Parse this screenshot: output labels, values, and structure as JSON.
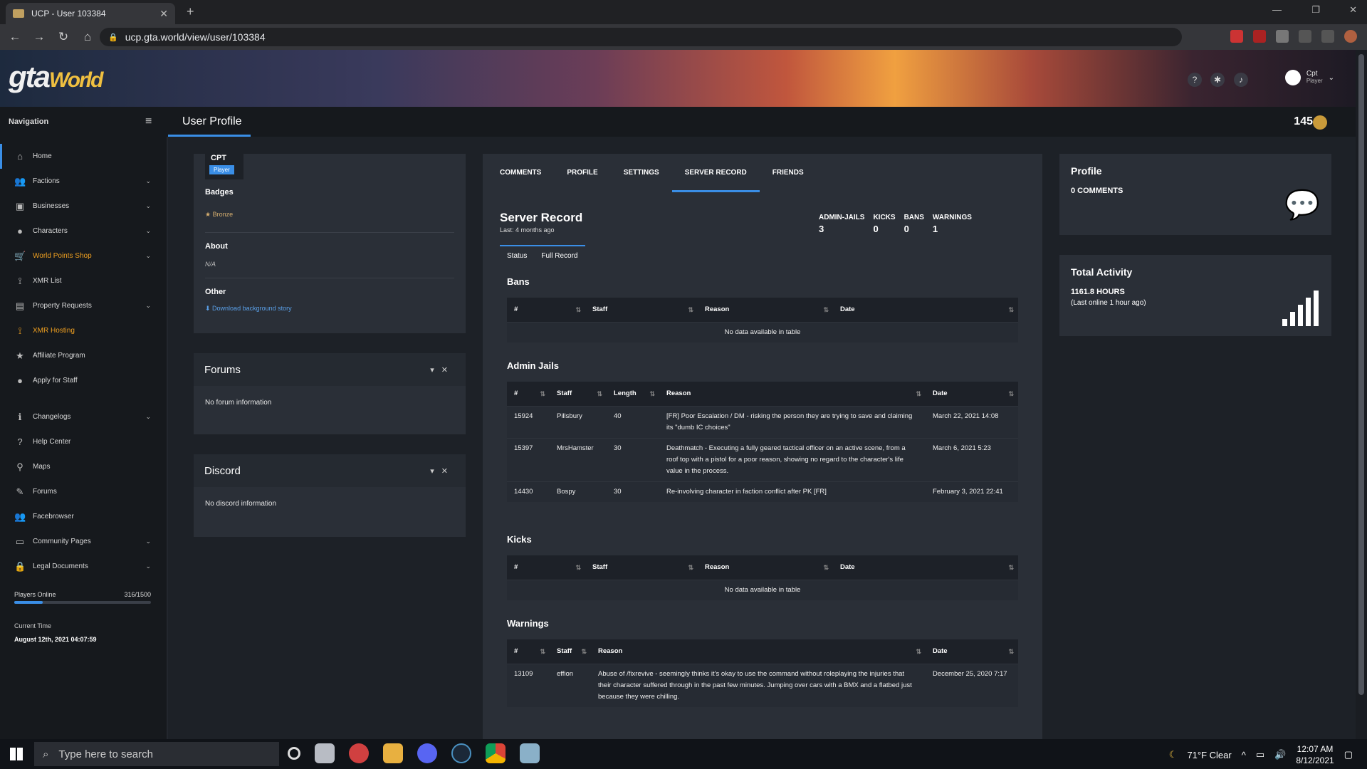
{
  "browser": {
    "tab_title": "UCP - User 103384",
    "url": "ucp.gta.world/view/user/103384"
  },
  "header": {
    "logo_text": "gta",
    "logo_sub": "World",
    "user_name": "Cpt",
    "user_role": "Player",
    "coins": "145"
  },
  "nav": {
    "label": "Navigation",
    "page_title": "User Profile",
    "items": [
      {
        "label": "Home",
        "icon": "home-icon"
      },
      {
        "label": "Factions",
        "icon": "users-icon"
      },
      {
        "label": "Businesses",
        "icon": "briefcase-icon"
      },
      {
        "label": "Characters",
        "icon": "user-icon"
      },
      {
        "label": "World Points Shop",
        "icon": "cart-icon"
      },
      {
        "label": "XMR List",
        "icon": "antenna-icon"
      },
      {
        "label": "Property Requests",
        "icon": "building-icon"
      },
      {
        "label": "XMR Hosting",
        "icon": "antenna-icon"
      },
      {
        "label": "Affiliate Program",
        "icon": "star-icon"
      },
      {
        "label": "Apply for Staff",
        "icon": "user-plus-icon"
      },
      {
        "label": "Changelogs",
        "icon": "info-icon"
      },
      {
        "label": "Help Center",
        "icon": "question-icon"
      },
      {
        "label": "Maps",
        "icon": "map-pin-icon"
      },
      {
        "label": "Forums",
        "icon": "edit-icon"
      },
      {
        "label": "Facebrowser",
        "icon": "users-icon"
      },
      {
        "label": "Community Pages",
        "icon": "window-icon"
      },
      {
        "label": "Legal Documents",
        "icon": "lock-icon"
      }
    ],
    "players_online_label": "Players Online",
    "players_online_count": "316/1500",
    "players_online_fraction": 0.21,
    "current_time_label": "Current Time",
    "current_time": "August 12th, 2021 04:07:59"
  },
  "profile_card": {
    "name": "CPT",
    "role": "Player",
    "badges_label": "Badges",
    "badge": "Bronze",
    "about_label": "About",
    "about_value": "N/A",
    "other_label": "Other",
    "download_link": "Download background story"
  },
  "forums_panel": {
    "title": "Forums",
    "body": "No forum information"
  },
  "discord_panel": {
    "title": "Discord",
    "body": "No discord information"
  },
  "center": {
    "tabs": [
      "COMMENTS",
      "PROFILE",
      "SETTINGS",
      "SERVER RECORD",
      "FRIENDS"
    ],
    "title": "Server Record",
    "subtitle": "Last: 4 months ago",
    "stats": [
      {
        "label": "ADMIN-JAILS",
        "value": "3"
      },
      {
        "label": "KICKS",
        "value": "0"
      },
      {
        "label": "BANS",
        "value": "0"
      },
      {
        "label": "WARNINGS",
        "value": "1"
      }
    ],
    "subtabs": [
      "Status",
      "Full Record"
    ],
    "no_data": "No data available in table",
    "bans": {
      "title": "Bans",
      "headers": [
        "#",
        "Staff",
        "Reason",
        "Date"
      ]
    },
    "jails": {
      "title": "Admin Jails",
      "headers": [
        "#",
        "Staff",
        "Length",
        "Reason",
        "Date"
      ],
      "rows": [
        {
          "id": "15924",
          "staff": "Pillsbury",
          "length": "40",
          "reason": "[FR] Poor Escalation / DM - risking the person they are trying to save and claiming its \"dumb IC choices\"",
          "date": "March 22, 2021 14:08"
        },
        {
          "id": "15397",
          "staff": "MrsHamster",
          "length": "30",
          "reason": "Deathmatch - Executing a fully geared tactical officer on an active scene, from a roof top with a pistol for a poor reason, showing no regard to the character's life value in the process.",
          "date": "March 6, 2021 5:23"
        },
        {
          "id": "14430",
          "staff": "Bospy",
          "length": "30",
          "reason": "Re-involving character in faction conflict after PK [FR]",
          "date": "February 3, 2021 22:41"
        }
      ]
    },
    "kicks": {
      "title": "Kicks",
      "headers": [
        "#",
        "Staff",
        "Reason",
        "Date"
      ]
    },
    "warnings": {
      "title": "Warnings",
      "headers": [
        "#",
        "Staff",
        "Reason",
        "Date"
      ],
      "rows": [
        {
          "id": "13109",
          "staff": "effion",
          "reason": "Abuse of /fixrevive - seemingly thinks it's okay to use the command without roleplaying the injuries that their character suffered through in the past few minutes. Jumping over cars with a BMX and a flatbed just because they were chilling.",
          "date": "December 25, 2020 7:17"
        }
      ]
    }
  },
  "right": {
    "profile_title": "Profile",
    "comments": "0 COMMENTS",
    "activity_title": "Total Activity",
    "hours": "1161.8 HOURS",
    "last_online": "(Last online 1 hour ago)"
  },
  "taskbar": {
    "search_placeholder": "Type here to search",
    "weather": "71°F  Clear",
    "time": "12:07 AM",
    "date": "8/12/2021"
  }
}
